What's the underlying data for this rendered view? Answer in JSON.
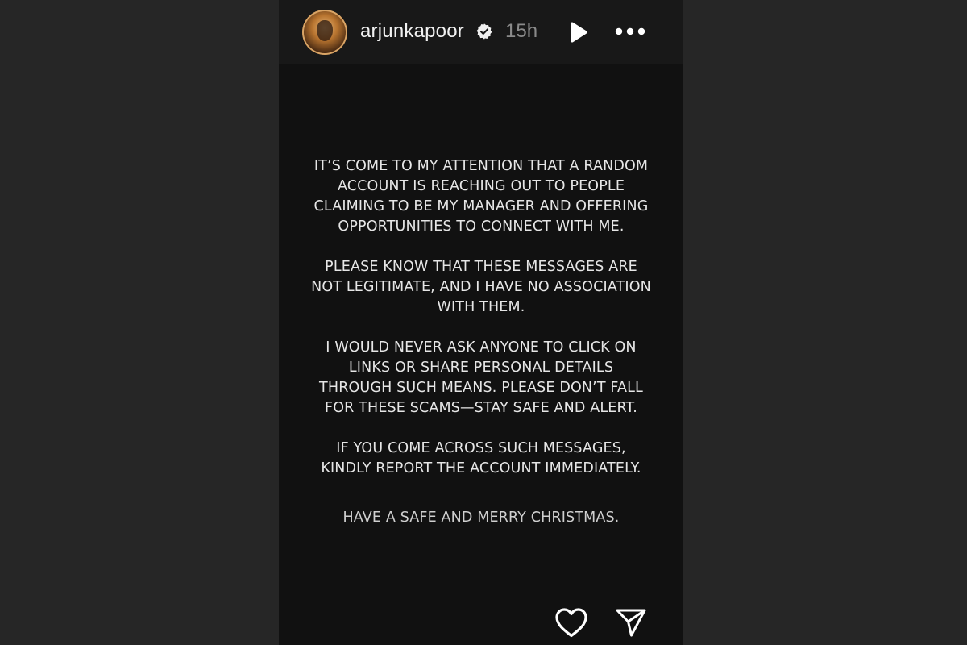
{
  "story": {
    "username": "arjunkapoor",
    "time_ago": "15h",
    "paragraphs": [
      {
        "lines": [
          "IT’S COME TO MY ATTENTION THAT A RANDOM",
          "ACCOUNT IS REACHING OUT TO PEOPLE",
          "CLAIMING TO BE MY MANAGER AND OFFERING",
          "OPPORTUNITIES TO CONNECT WITH ME."
        ]
      },
      {
        "lines": [
          "PLEASE KNOW THAT THESE MESSAGES ARE",
          "NOT LEGITIMATE, AND I HAVE NO ASSOCIATION",
          "WITH THEM."
        ]
      },
      {
        "lines": [
          "I WOULD NEVER ASK ANYONE TO CLICK ON",
          "LINKS OR SHARE PERSONAL DETAILS",
          "THROUGH SUCH MEANS. PLEASE DON’T FALL",
          "FOR THESE SCAMS—STAY SAFE AND ALERT."
        ]
      },
      {
        "lines": [
          "IF YOU COME ACROSS SUCH MESSAGES,",
          "KINDLY REPORT THE ACCOUNT IMMEDIATELY."
        ]
      },
      {
        "lines": [
          "HAVE A SAFE AND MERRY CHRISTMAS."
        ]
      }
    ]
  },
  "icons": {
    "avatar": "profile-photo",
    "verified": "verified-badge-icon",
    "play": "play-icon",
    "more": "more-options-icon",
    "like": "heart-icon",
    "share": "paper-plane-icon"
  },
  "colors": {
    "page_background": "#262626",
    "story_background": "#111111",
    "text": "#e6e6e6",
    "timestamp": "#8a8a8a",
    "icon": "#ffffff"
  }
}
